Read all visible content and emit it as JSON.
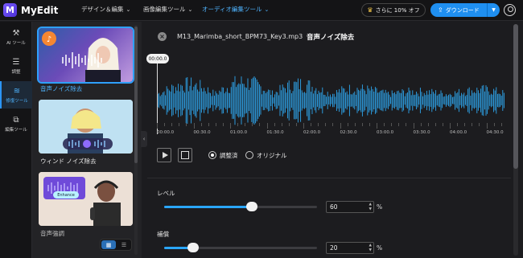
{
  "app": {
    "name": "MyEdit",
    "logo_letter": "M"
  },
  "nav": [
    {
      "label": "デザイン＆編集",
      "active": false
    },
    {
      "label": "画像編集ツール",
      "active": false
    },
    {
      "label": "オーディオ編集ツール",
      "active": true
    }
  ],
  "promo": {
    "label": "さらに 10% オフ",
    "icon": "crown-icon"
  },
  "download": {
    "label": "ダウンロード",
    "icon": "cloud-upload-icon"
  },
  "rail": [
    {
      "label": "AI ツール",
      "icon": "magic-wand-icon"
    },
    {
      "label": "調整",
      "icon": "sliders-icon"
    },
    {
      "label": "修復ツール",
      "icon": "audio-repair-icon",
      "active": true
    },
    {
      "label": "編集ツール",
      "icon": "crop-icon"
    }
  ],
  "tools": [
    {
      "label": "音声ノイズ除去",
      "selected": true
    },
    {
      "label": "ウィンド ノイズ除去",
      "selected": false
    },
    {
      "label": "音声強調",
      "selected": false,
      "badge": "Enhance"
    }
  ],
  "editor": {
    "filename": "M13_Marimba_short_BPM73_Key3.mp3",
    "title": "音声ノイズ除去",
    "current_time": "00:00.0",
    "ticks": [
      "00:00.0",
      "00:30.0",
      "01:00.0",
      "01:30.0",
      "02:00.0",
      "02:30.0",
      "03:00.0",
      "03:30.0",
      "04:00.0",
      "04:30.0"
    ],
    "radio": [
      {
        "label": "調整済",
        "checked": true
      },
      {
        "label": "オリジナル",
        "checked": false
      }
    ],
    "wave_color": "#2ea8f0"
  },
  "controls": [
    {
      "label": "レベル",
      "value": "60",
      "unit": "%",
      "level": 0.6
    },
    {
      "label": "補償",
      "value": "20",
      "unit": "%",
      "level": 0.2
    }
  ]
}
